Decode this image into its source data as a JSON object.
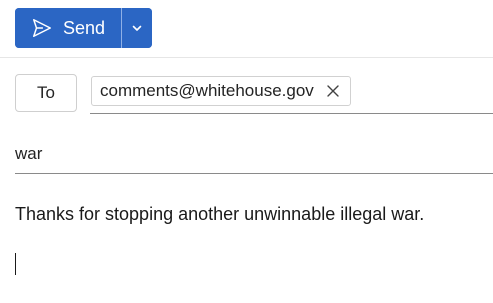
{
  "toolbar": {
    "send_label": "Send",
    "send_icon": "paper-plane-icon",
    "dropdown_icon": "chevron-down-icon",
    "accent": "#2b66c4"
  },
  "recipients": {
    "to_label": "To",
    "chips": [
      {
        "address": "comments@whitehouse.gov",
        "remove_icon": "close-icon"
      }
    ]
  },
  "subject": {
    "value": "war"
  },
  "body": {
    "text": "Thanks for stopping another unwinnable illegal war."
  }
}
